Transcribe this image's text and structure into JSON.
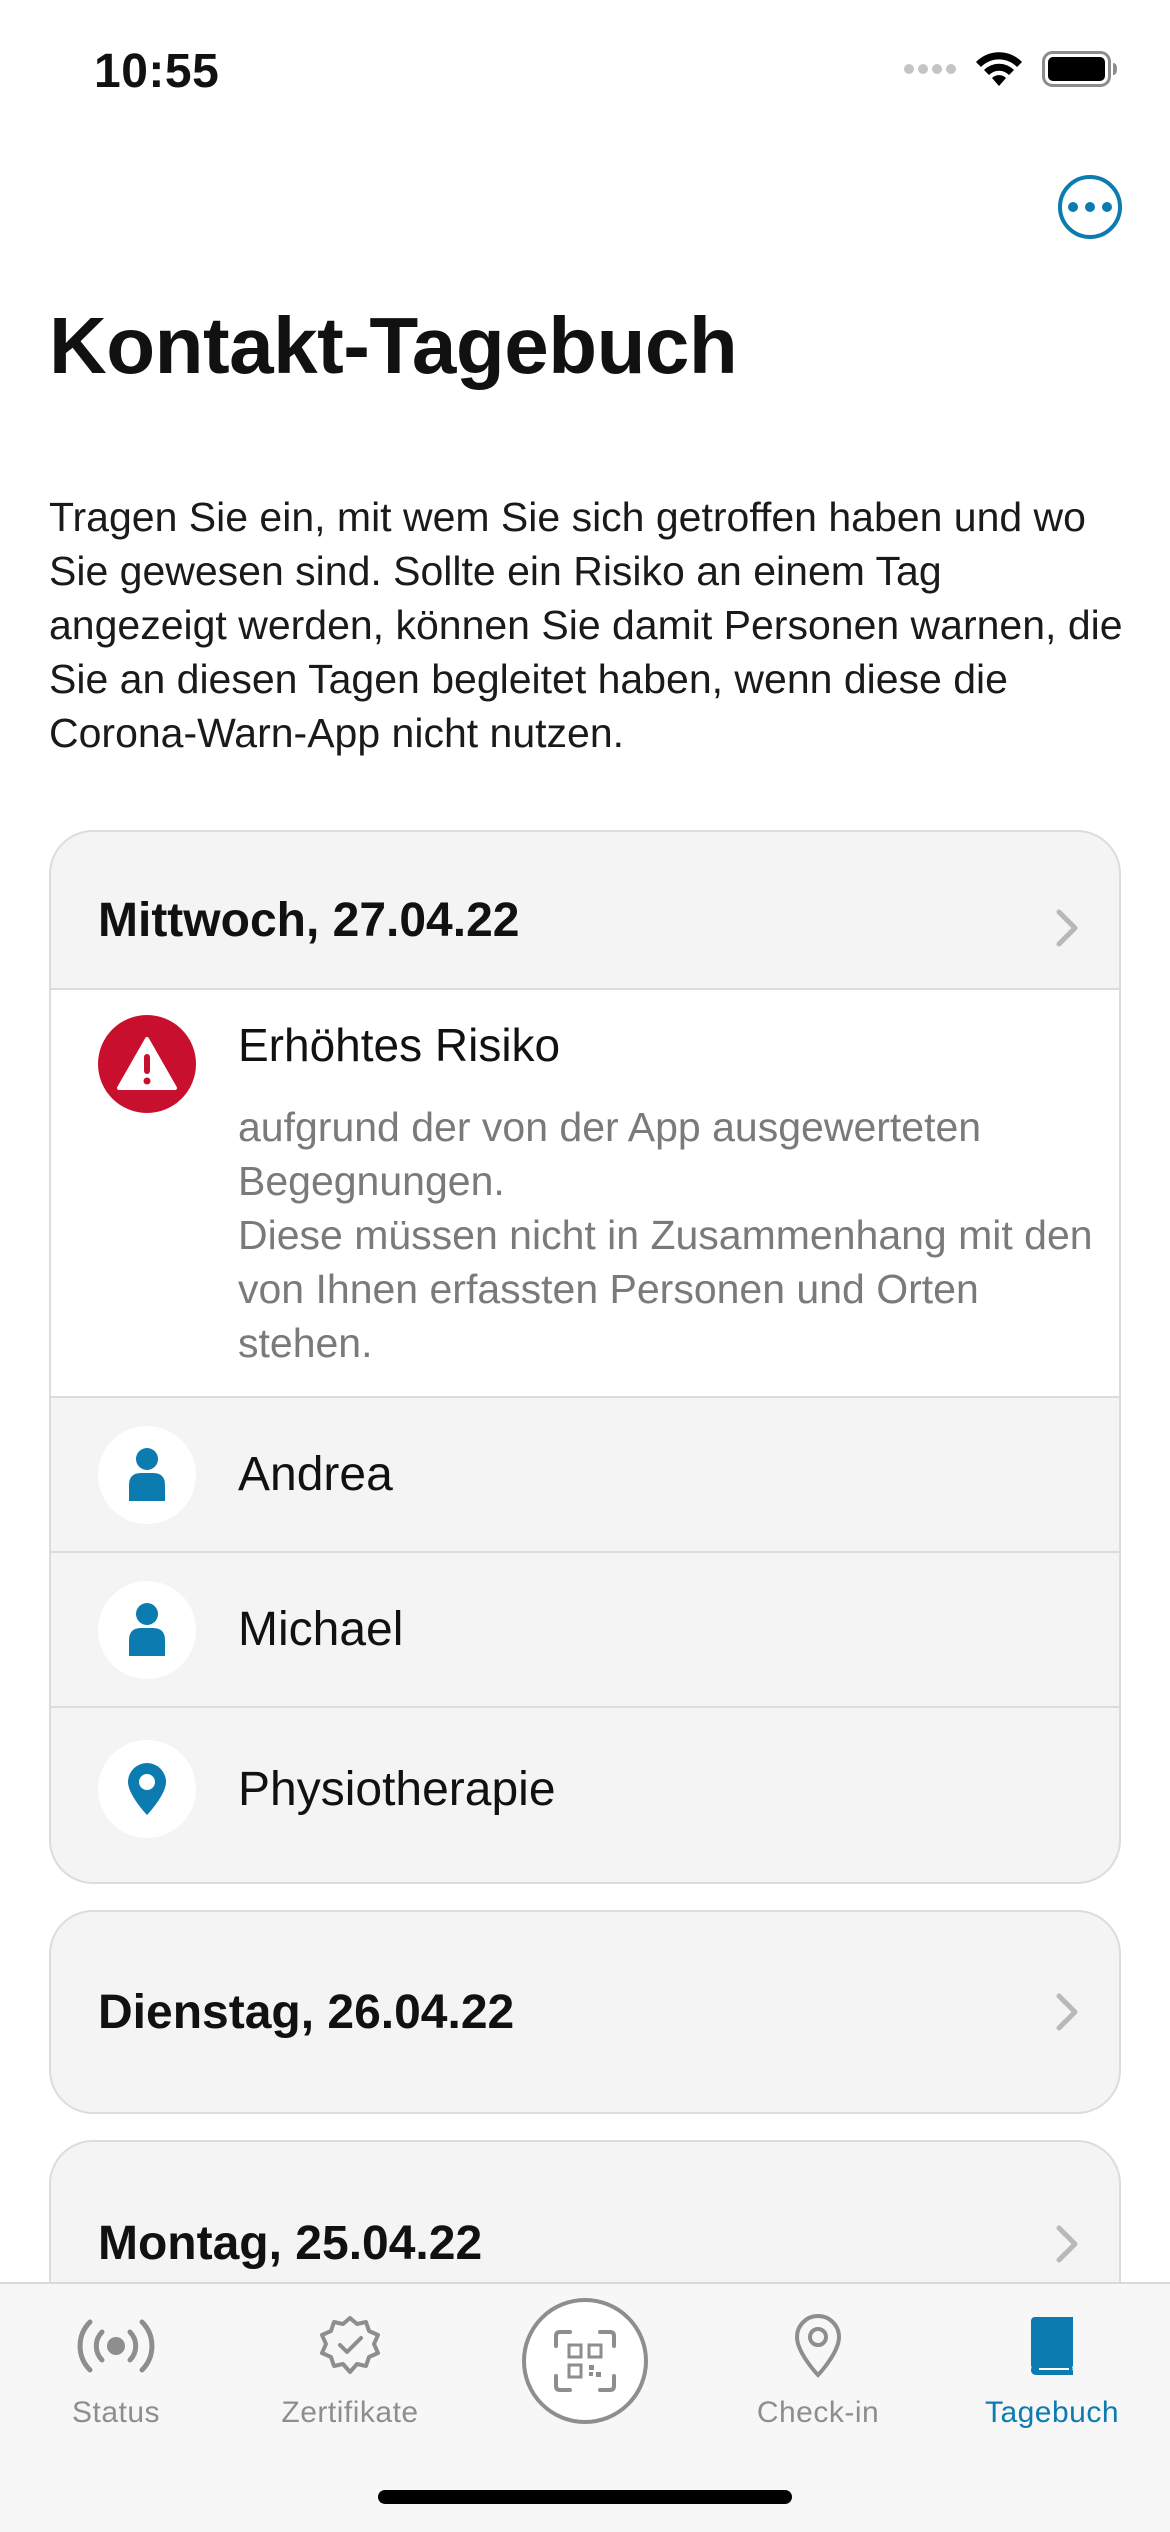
{
  "status_bar": {
    "time": "10:55"
  },
  "header": {
    "title": "Kontakt-Tagebuch",
    "more_icon": "ellipsis-circle-icon",
    "description": "Tragen Sie ein, mit wem Sie sich getroffen haben und wo Sie gewesen sind. Sollte ein Risiko an einem Tag angezeigt werden, können Sie damit Personen warnen, die Sie an diesen Tagen begleitet haben, wenn diese die Corona-Warn-App nicht nutzen."
  },
  "days": [
    {
      "label": "Mittwoch, 27.04.22",
      "risk": {
        "title": "Erhöhtes Risiko",
        "text": "aufgrund der von der App ausgewerteten Begegnungen.\nDiese müssen nicht in Zusammenhang mit den von Ihnen erfassten Personen und Orten stehen.",
        "icon": "warning-icon",
        "color": "#c8102e"
      },
      "entries": [
        {
          "label": "Andrea",
          "icon": "person-icon"
        },
        {
          "label": "Michael",
          "icon": "person-icon"
        },
        {
          "label": "Physiotherapie",
          "icon": "location-pin-icon"
        }
      ]
    },
    {
      "label": "Dienstag, 26.04.22"
    },
    {
      "label": "Montag, 25.04.22"
    }
  ],
  "tab_bar": {
    "tabs": [
      {
        "label": "Status",
        "icon": "radar-icon",
        "active": false
      },
      {
        "label": "Zertifikate",
        "icon": "certificate-badge-icon",
        "active": false
      },
      {
        "label": "",
        "icon": "qr-scan-icon",
        "active": false
      },
      {
        "label": "Check-in",
        "icon": "location-pin-icon",
        "active": false
      },
      {
        "label": "Tagebuch",
        "icon": "book-icon",
        "active": true
      }
    ]
  },
  "colors": {
    "accent": "#0b7bb0",
    "risk_high": "#c8102e",
    "inactive": "#8e8e8e"
  }
}
